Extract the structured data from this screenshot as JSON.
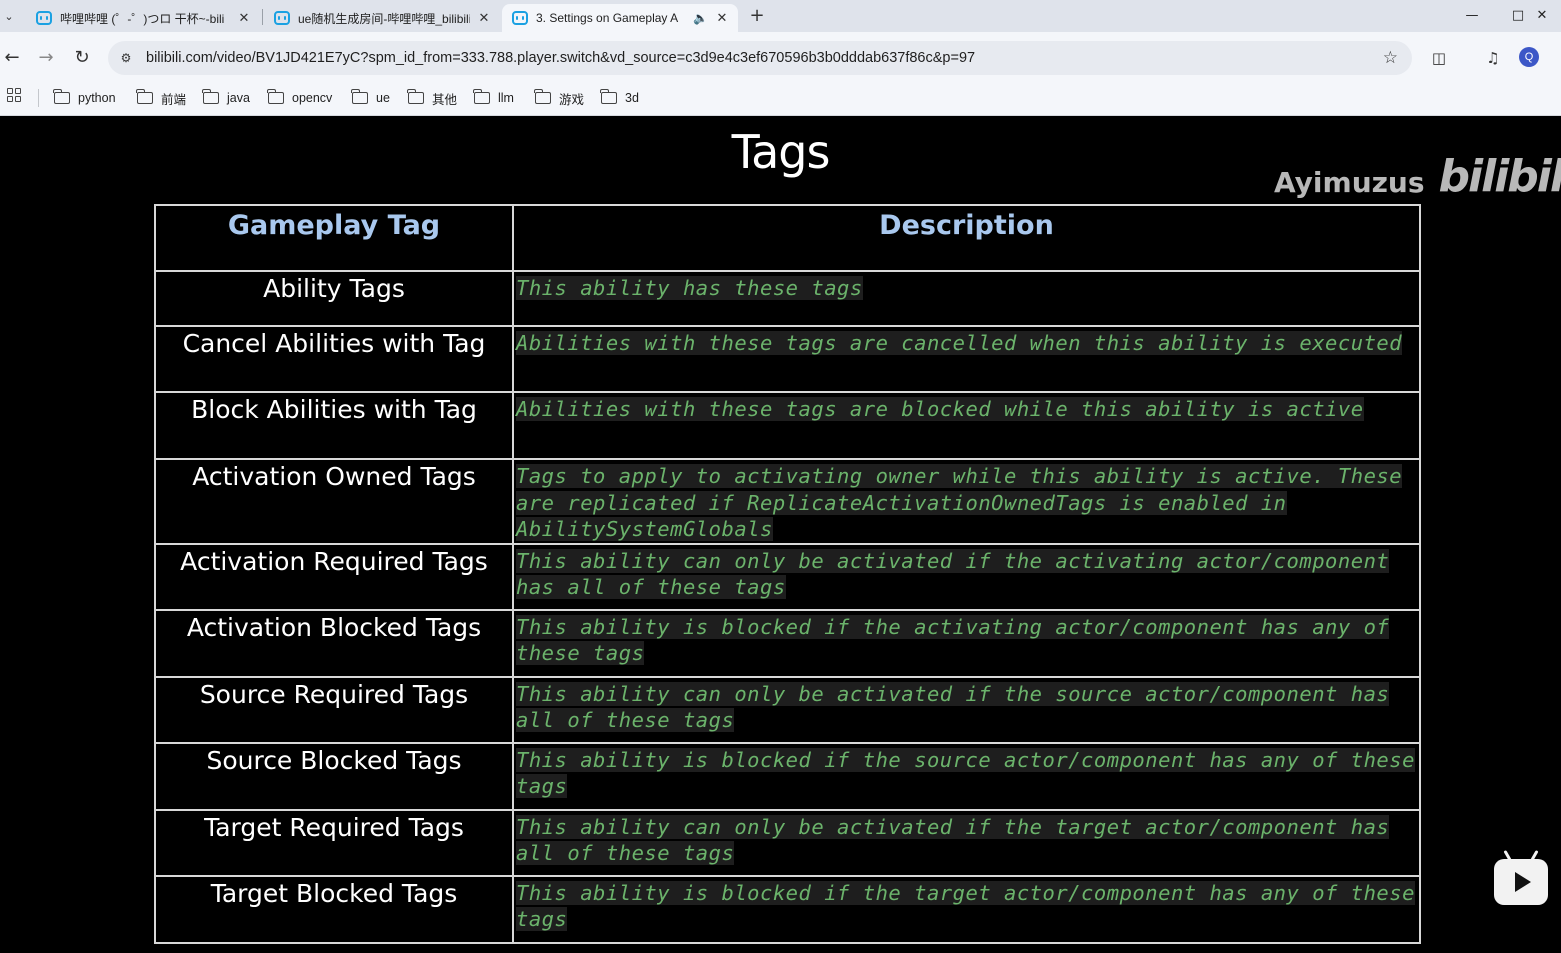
{
  "tabs": [
    {
      "title": "哔哩哔哩 (゜-゜)つロ 干杯~-bili",
      "active": false
    },
    {
      "title": "ue随机生成房间-哔哩哔哩_bilibili",
      "active": false
    },
    {
      "title": "3. Settings on Gameplay A",
      "active": true
    }
  ],
  "address_bar": {
    "url": "bilibili.com/video/BV1JD421E7yC?spm_id_from=333.788.player.switch&vd_source=c3d9e4c3ef670596b3b0dddab637f86c&p=97"
  },
  "profile_initial": "Q",
  "bookmarks": [
    "python",
    "前端",
    "java",
    "opencv",
    "ue",
    "其他",
    "llm",
    "游戏",
    "3d"
  ],
  "slide": {
    "title": "Tags",
    "watermark_user": "Ayimuzus",
    "watermark_logo": "bilibili",
    "columns": [
      "Gameplay Tag",
      "Description"
    ],
    "rows": [
      {
        "tag": "Ability Tags",
        "desc": "This ability has these tags"
      },
      {
        "tag": "Cancel Abilities with Tag",
        "desc": "Abilities with these tags are cancelled when this ability is executed"
      },
      {
        "tag": "Block Abilities with Tag",
        "desc": "Abilities with these tags are blocked while this ability is active"
      },
      {
        "tag": "Activation Owned Tags",
        "desc": "Tags to apply to activating owner while this ability is active. These are replicated if ReplicateActivationOwnedTags is enabled in AbilitySystemGlobals"
      },
      {
        "tag": "Activation Required Tags",
        "desc": "This ability can only be activated if the activating actor/component has all of these tags"
      },
      {
        "tag": "Activation Blocked Tags",
        "desc": "This ability is blocked if the activating actor/component has any of these tags"
      },
      {
        "tag": "Source Required Tags",
        "desc": "This ability can only be activated if the source actor/component has all of these tags"
      },
      {
        "tag": "Source Blocked Tags",
        "desc": "This ability is blocked if the source actor/component has any of these tags"
      },
      {
        "tag": "Target Required Tags",
        "desc": "This ability can only be activated if the target actor/component has all of these tags"
      },
      {
        "tag": "Target Blocked Tags",
        "desc": "This ability is blocked if the target actor/component has any of these tags"
      }
    ]
  }
}
